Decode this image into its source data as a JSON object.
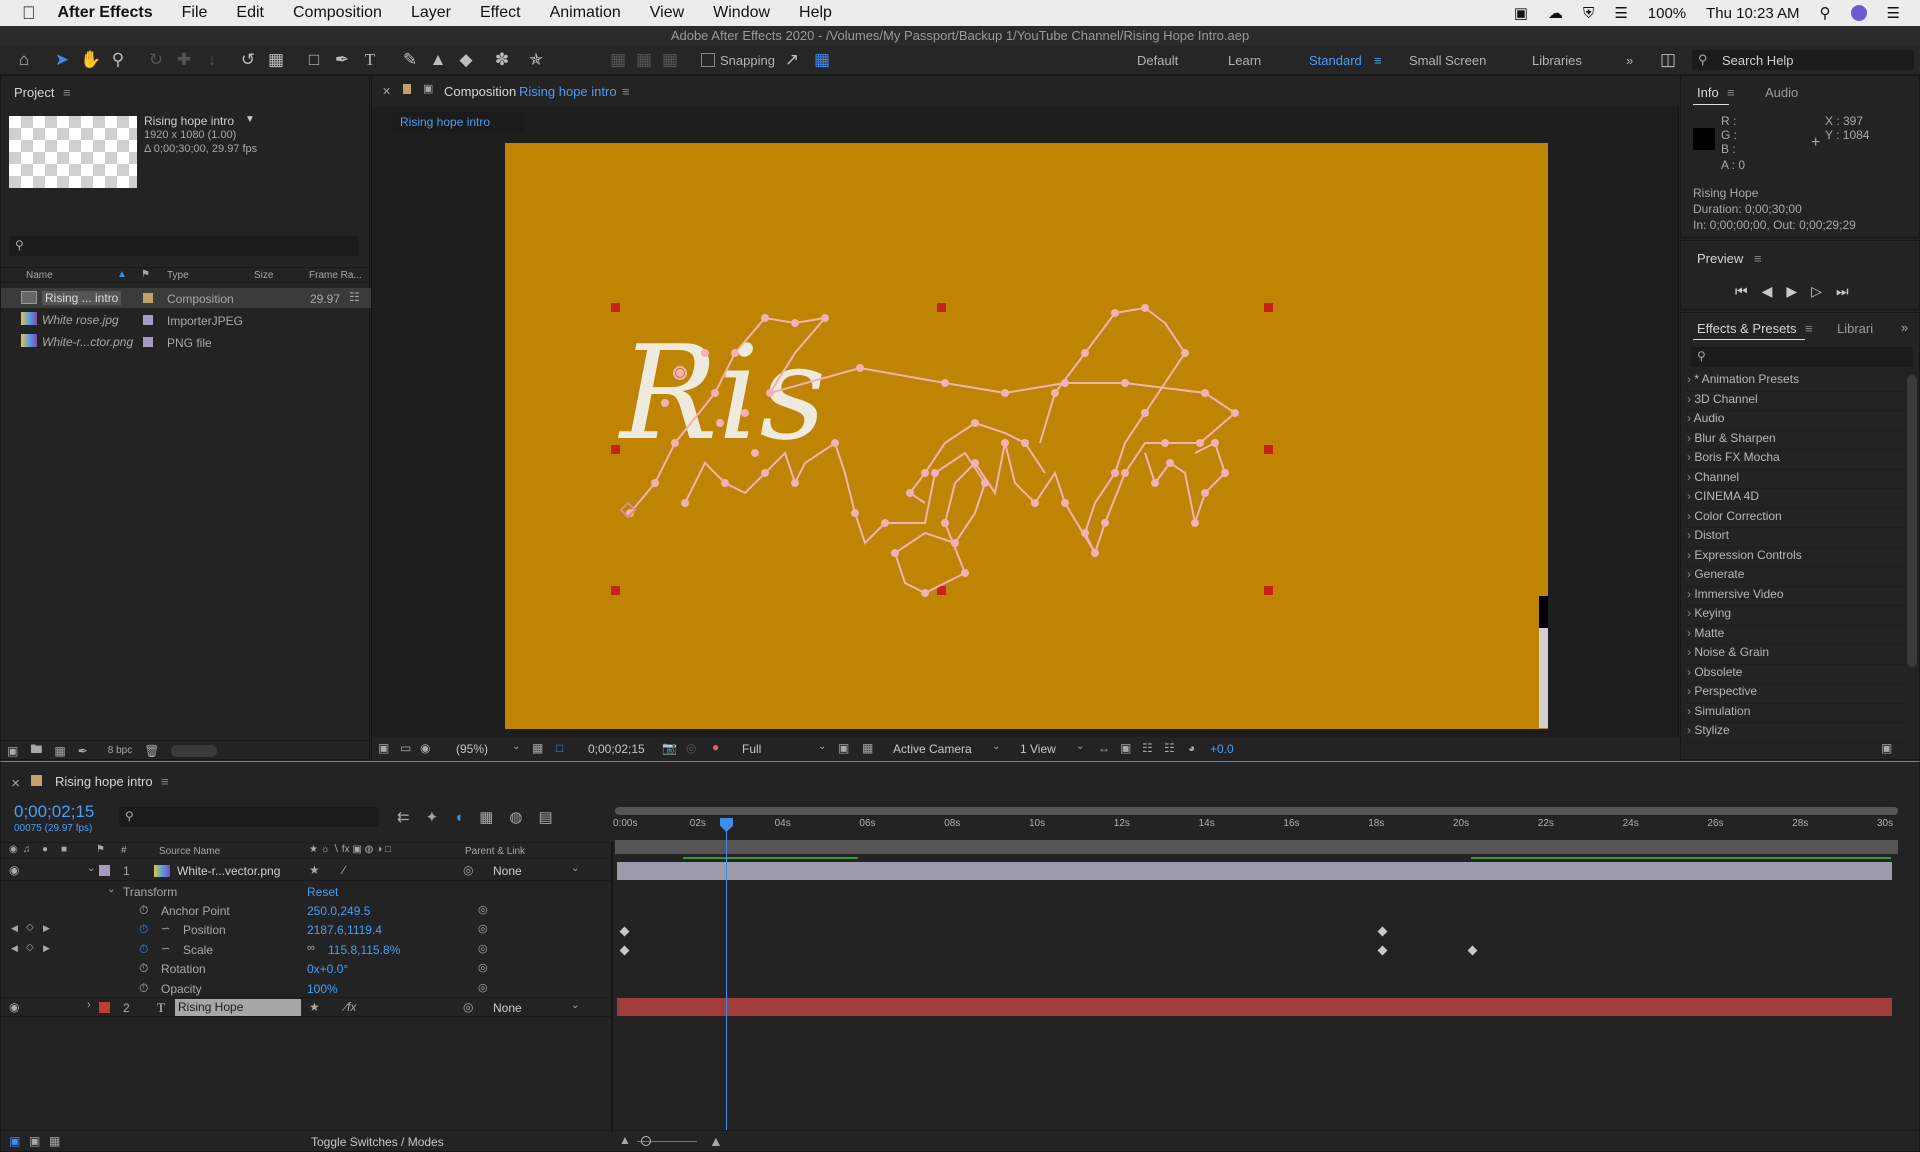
{
  "menubar": {
    "app": "After Effects",
    "items": [
      "File",
      "Edit",
      "Composition",
      "Layer",
      "Effect",
      "Animation",
      "View",
      "Window",
      "Help"
    ],
    "battery": "100%",
    "clock": "Thu 10:23 AM"
  },
  "window_title": "Adobe After Effects 2020 - /Volumes/My Passport/Backup 1/YouTube Channel/Rising Hope Intro.aep",
  "toolbar": {
    "snapping": "Snapping",
    "workspaces": [
      "Default",
      "Learn",
      "Standard",
      "Small Screen",
      "Libraries"
    ],
    "active_workspace": "Standard",
    "search_help": "Search Help"
  },
  "project": {
    "title": "Project",
    "comp_name": "Rising hope intro",
    "comp_res": "1920 x 1080 (1.00)",
    "comp_dur": "Δ 0;00;30;00, 29.97 fps",
    "columns": {
      "name": "Name",
      "type": "Type",
      "size": "Size",
      "framerate": "Frame Ra..."
    },
    "items": [
      {
        "name": "Rising ... intro",
        "type": "Composition",
        "fps": "29.97",
        "color": "#c2a26a"
      },
      {
        "name": "White rose.jpg",
        "type": "ImporterJPEG",
        "fps": "",
        "color": "#a69ac5"
      },
      {
        "name": "White-r...ctor.png",
        "type": "PNG file",
        "fps": "",
        "color": "#a69ac5"
      }
    ],
    "bpc": "8 bpc"
  },
  "composition": {
    "label": "Composition",
    "name": "Rising hope intro",
    "tab": "Rising hope intro",
    "bg_color": "#c08403",
    "zoom": "(95%)",
    "timecode": "0;00;02;15",
    "resolution": "Full",
    "camera": "Active Camera",
    "views": "1 View",
    "exposure": "+0.0"
  },
  "info": {
    "tab_info": "Info",
    "tab_audio": "Audio",
    "r": "R :",
    "g": "G :",
    "b": "B :",
    "a": "A : 0",
    "x": "X : 397",
    "y": "Y : 1084",
    "layer_name": "Rising Hope",
    "duration": "Duration: 0;00;30;00",
    "inout": "In: 0;00;00;00, Out: 0;00;29;29"
  },
  "preview": {
    "title": "Preview"
  },
  "effects": {
    "tab": "Effects & Presets",
    "tab2": "Librari",
    "list": [
      "* Animation Presets",
      "3D Channel",
      "Audio",
      "Blur & Sharpen",
      "Boris FX Mocha",
      "Channel",
      "CINEMA 4D",
      "Color Correction",
      "Distort",
      "Expression Controls",
      "Generate",
      "Immersive Video",
      "Keying",
      "Matte",
      "Noise & Grain",
      "Obsolete",
      "Perspective",
      "Simulation",
      "Stylize"
    ]
  },
  "timeline": {
    "comp_tab": "Rising hope intro",
    "timecode": "0;00;02;15",
    "frame_info": "00075 (29.97 fps)",
    "col_source": "Source Name",
    "col_parent": "Parent & Link",
    "ruler": [
      "0:00s",
      "02s",
      "04s",
      "06s",
      "08s",
      "10s",
      "12s",
      "14s",
      "16s",
      "18s",
      "20s",
      "22s",
      "24s",
      "26s",
      "28s",
      "30s"
    ],
    "layer1": {
      "num": "1",
      "name": "White-r...vector.png",
      "parent": "None",
      "color": "#a69ac5"
    },
    "transform": {
      "label": "Transform",
      "reset": "Reset",
      "props": [
        {
          "name": "Anchor Point",
          "value": "250.0,249.5"
        },
        {
          "name": "Position",
          "value": "2187.6,1119.4"
        },
        {
          "name": "Scale",
          "value": "115.8,115.8%"
        },
        {
          "name": "Rotation",
          "value": "0x+0.0°"
        },
        {
          "name": "Opacity",
          "value": "100%"
        }
      ]
    },
    "layer2": {
      "num": "2",
      "name": "Rising Hope",
      "parent": "None",
      "color": "#c23b3b"
    },
    "toggle": "Toggle Switches / Modes"
  }
}
